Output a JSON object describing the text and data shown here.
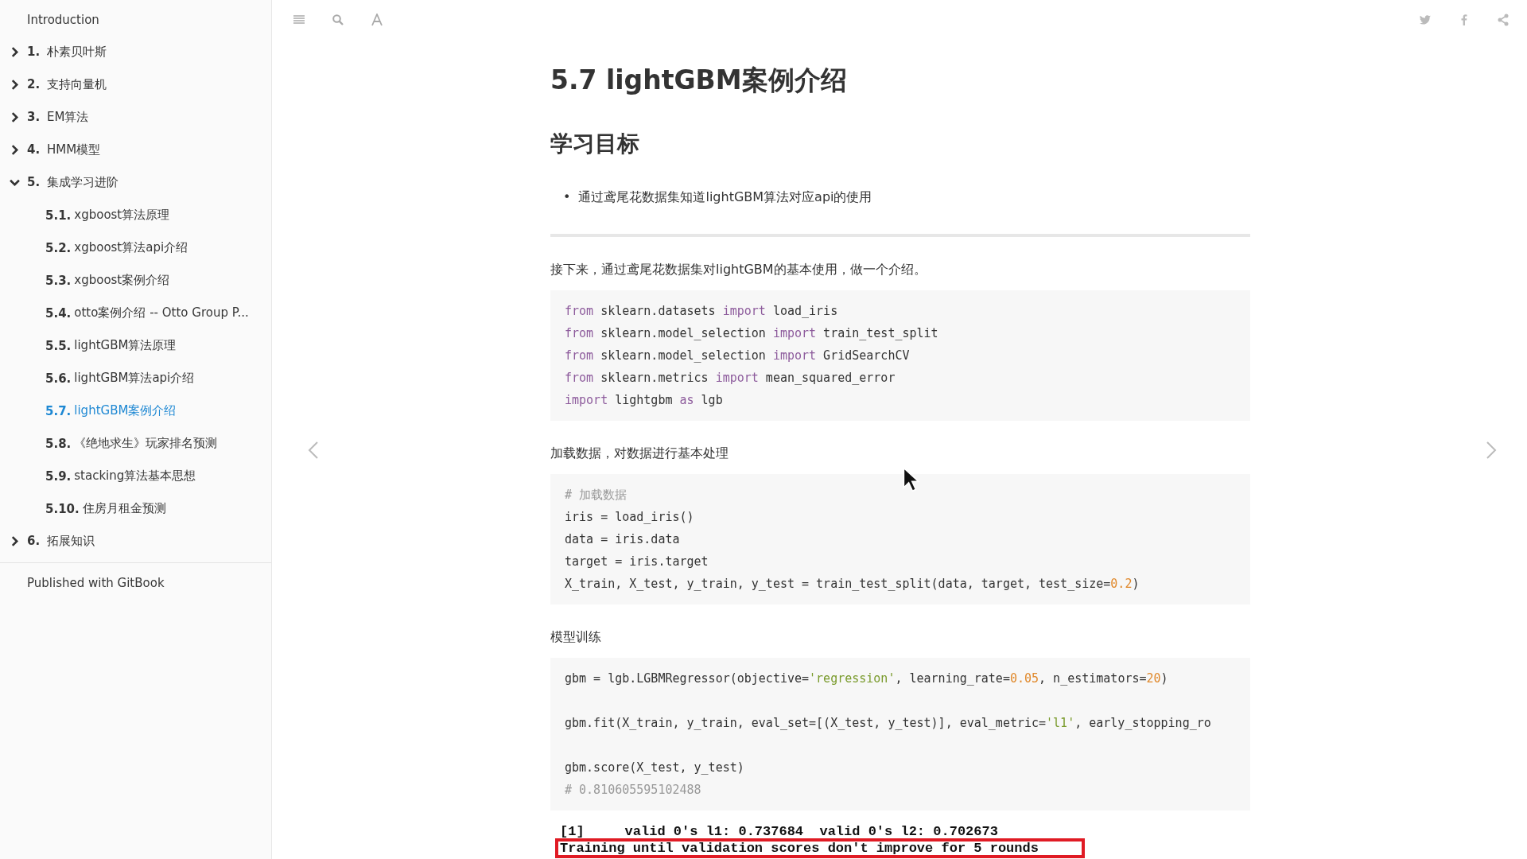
{
  "sidebar": {
    "intro": {
      "label": "Introduction",
      "selected": false
    },
    "chapters": [
      {
        "number": "1.",
        "title": "朴素贝叶斯",
        "expanded": false,
        "selected": false
      },
      {
        "number": "2.",
        "title": "支持向量机",
        "expanded": false,
        "selected": false
      },
      {
        "number": "3.",
        "title": "EM算法",
        "expanded": false,
        "selected": false
      },
      {
        "number": "4.",
        "title": "HMM模型",
        "expanded": false,
        "selected": false
      },
      {
        "number": "5.",
        "title": "集成学习进阶",
        "expanded": true,
        "selected": false,
        "children": [
          {
            "number": "5.1.",
            "title": "xgboost算法原理",
            "selected": false
          },
          {
            "number": "5.2.",
            "title": "xgboost算法api介绍",
            "selected": false
          },
          {
            "number": "5.3.",
            "title": "xgboost案例介绍",
            "selected": false
          },
          {
            "number": "5.4.",
            "title": "otto案例介绍 -- Otto Group P...",
            "selected": false
          },
          {
            "number": "5.5.",
            "title": "lightGBM算法原理",
            "selected": false
          },
          {
            "number": "5.6.",
            "title": "lightGBM算法api介绍",
            "selected": false
          },
          {
            "number": "5.7.",
            "title": "lightGBM案例介绍",
            "selected": true
          },
          {
            "number": "5.8.",
            "title": "《绝地求生》玩家排名预测",
            "selected": false
          },
          {
            "number": "5.9.",
            "title": "stacking算法基本思想",
            "selected": false
          },
          {
            "number": "5.10.",
            "title": "住房月租金预测",
            "selected": false
          }
        ]
      },
      {
        "number": "6.",
        "title": "拓展知识",
        "expanded": false,
        "selected": false
      }
    ],
    "footer": "Published with GitBook"
  },
  "page": {
    "title": "5.7 lightGBM案例介绍",
    "blocks": [
      {
        "kind": "heading",
        "text": "学习目标"
      },
      {
        "kind": "bullets",
        "items": [
          {
            "marker": "•",
            "text": "通过鸢尾花数据集知道lightGBM算法对应api的使用"
          }
        ]
      },
      {
        "kind": "rule"
      },
      {
        "kind": "paragraph",
        "text": "接下来，通过鸢尾花数据集对lightGBM的基本使用，做一个介绍。"
      },
      {
        "kind": "code",
        "lines": [
          {
            "tokens": [
              {
                "kind": "keyword",
                "text": "from"
              },
              {
                "kind": "plain",
                "text": " sklearn.datasets "
              },
              {
                "kind": "keyword",
                "text": "import"
              },
              {
                "kind": "plain",
                "text": " load_iris"
              }
            ]
          },
          {
            "tokens": [
              {
                "kind": "keyword",
                "text": "from"
              },
              {
                "kind": "plain",
                "text": " sklearn.model_selection "
              },
              {
                "kind": "keyword",
                "text": "import"
              },
              {
                "kind": "plain",
                "text": " train_test_split"
              }
            ]
          },
          {
            "tokens": [
              {
                "kind": "keyword",
                "text": "from"
              },
              {
                "kind": "plain",
                "text": " sklearn.model_selection "
              },
              {
                "kind": "keyword",
                "text": "import"
              },
              {
                "kind": "plain",
                "text": " GridSearchCV"
              }
            ]
          },
          {
            "tokens": [
              {
                "kind": "keyword",
                "text": "from"
              },
              {
                "kind": "plain",
                "text": " sklearn.metrics "
              },
              {
                "kind": "keyword",
                "text": "import"
              },
              {
                "kind": "plain",
                "text": " mean_squared_error"
              }
            ]
          },
          {
            "tokens": [
              {
                "kind": "keyword",
                "text": "import"
              },
              {
                "kind": "plain",
                "text": " lightgbm "
              },
              {
                "kind": "keyword",
                "text": "as"
              },
              {
                "kind": "plain",
                "text": " lgb"
              }
            ]
          }
        ]
      },
      {
        "kind": "paragraph",
        "text": "加载数据，对数据进行基本处理"
      },
      {
        "kind": "code",
        "lines": [
          {
            "tokens": [
              {
                "kind": "comment",
                "text": "# 加载数据"
              }
            ]
          },
          {
            "tokens": [
              {
                "kind": "plain",
                "text": "iris = load_iris()"
              }
            ]
          },
          {
            "tokens": [
              {
                "kind": "plain",
                "text": "data = iris.data"
              }
            ]
          },
          {
            "tokens": [
              {
                "kind": "plain",
                "text": "target = iris.target"
              }
            ]
          },
          {
            "tokens": [
              {
                "kind": "plain",
                "text": "X_train, X_test, y_train, y_test = train_test_split(data, target, test_size="
              },
              {
                "kind": "number",
                "text": "0.2"
              },
              {
                "kind": "plain",
                "text": ")"
              }
            ]
          }
        ]
      },
      {
        "kind": "paragraph",
        "text": "模型训练"
      },
      {
        "kind": "code",
        "lines": [
          {
            "blank_after": true,
            "tokens": [
              {
                "kind": "plain",
                "text": "gbm = lgb.LGBMRegressor(objective="
              },
              {
                "kind": "string",
                "text": "'regression'"
              },
              {
                "kind": "plain",
                "text": ", learning_rate="
              },
              {
                "kind": "number",
                "text": "0.05"
              },
              {
                "kind": "plain",
                "text": ", n_estimators="
              },
              {
                "kind": "number",
                "text": "20"
              },
              {
                "kind": "plain",
                "text": ")"
              }
            ]
          },
          {
            "blank_after": true,
            "tokens": [
              {
                "kind": "plain",
                "text": "gbm.fit(X_train, y_train, eval_set=[(X_test, y_test)], eval_metric="
              },
              {
                "kind": "string",
                "text": "'l1'"
              },
              {
                "kind": "plain",
                "text": ", early_stopping_ro"
              }
            ]
          },
          {
            "tokens": [
              {
                "kind": "plain",
                "text": "gbm.score(X_test, y_test)"
              }
            ]
          },
          {
            "tokens": [
              {
                "kind": "comment",
                "text": "# 0.810605595102488"
              }
            ]
          }
        ]
      },
      {
        "kind": "output",
        "lines": [
          {
            "text": "[1]     valid 0's l1: 0.737684  valid 0's l2: 0.702673",
            "highlighted": false
          },
          {
            "text": "Training until validation scores don't improve for 5 rounds",
            "highlighted": true
          }
        ]
      }
    ]
  }
}
